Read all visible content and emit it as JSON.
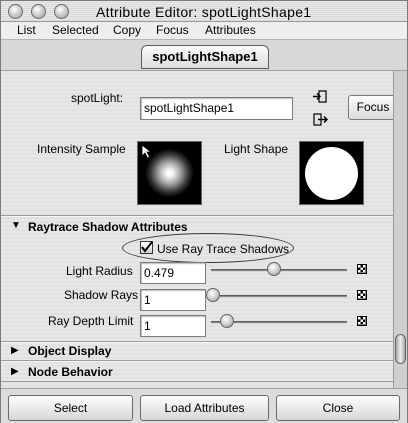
{
  "window": {
    "title": "Attribute Editor: spotLightShape1"
  },
  "menu": [
    "List",
    "Selected",
    "Copy",
    "Focus",
    "Attributes"
  ],
  "tab": {
    "label": "spotLightShape1"
  },
  "node": {
    "label": "spotLight:",
    "value": "spotLightShape1",
    "focus_label": "Focus"
  },
  "swatches": {
    "intensity_label": "Intensity Sample",
    "shape_label": "Light Shape"
  },
  "raytrace": {
    "title": "Raytrace Shadow Attributes",
    "checkbox_label": "Use Ray Trace Shadows",
    "checked": true,
    "light_radius_label": "Light Radius",
    "light_radius_value": "0.479",
    "light_radius_fraction": 0.479,
    "shadow_rays_label": "Shadow Rays",
    "shadow_rays_value": "1",
    "ray_depth_label": "Ray Depth Limit",
    "ray_depth_value": "1"
  },
  "sections": {
    "object_display": "Object Display",
    "node_behavior": "Node Behavior"
  },
  "buttons": {
    "select": "Select",
    "load": "Load Attributes",
    "close": "Close"
  },
  "icons": {
    "window_buttons": [
      "close-icon",
      "minimize-icon",
      "zoom-icon"
    ],
    "node_input": "input-connection-icon",
    "node_output": "output-connection-icon",
    "slider_end": "map-texture-icon",
    "expand": "triangle-expand-icon",
    "collapse": "triangle-collapse-icon"
  }
}
